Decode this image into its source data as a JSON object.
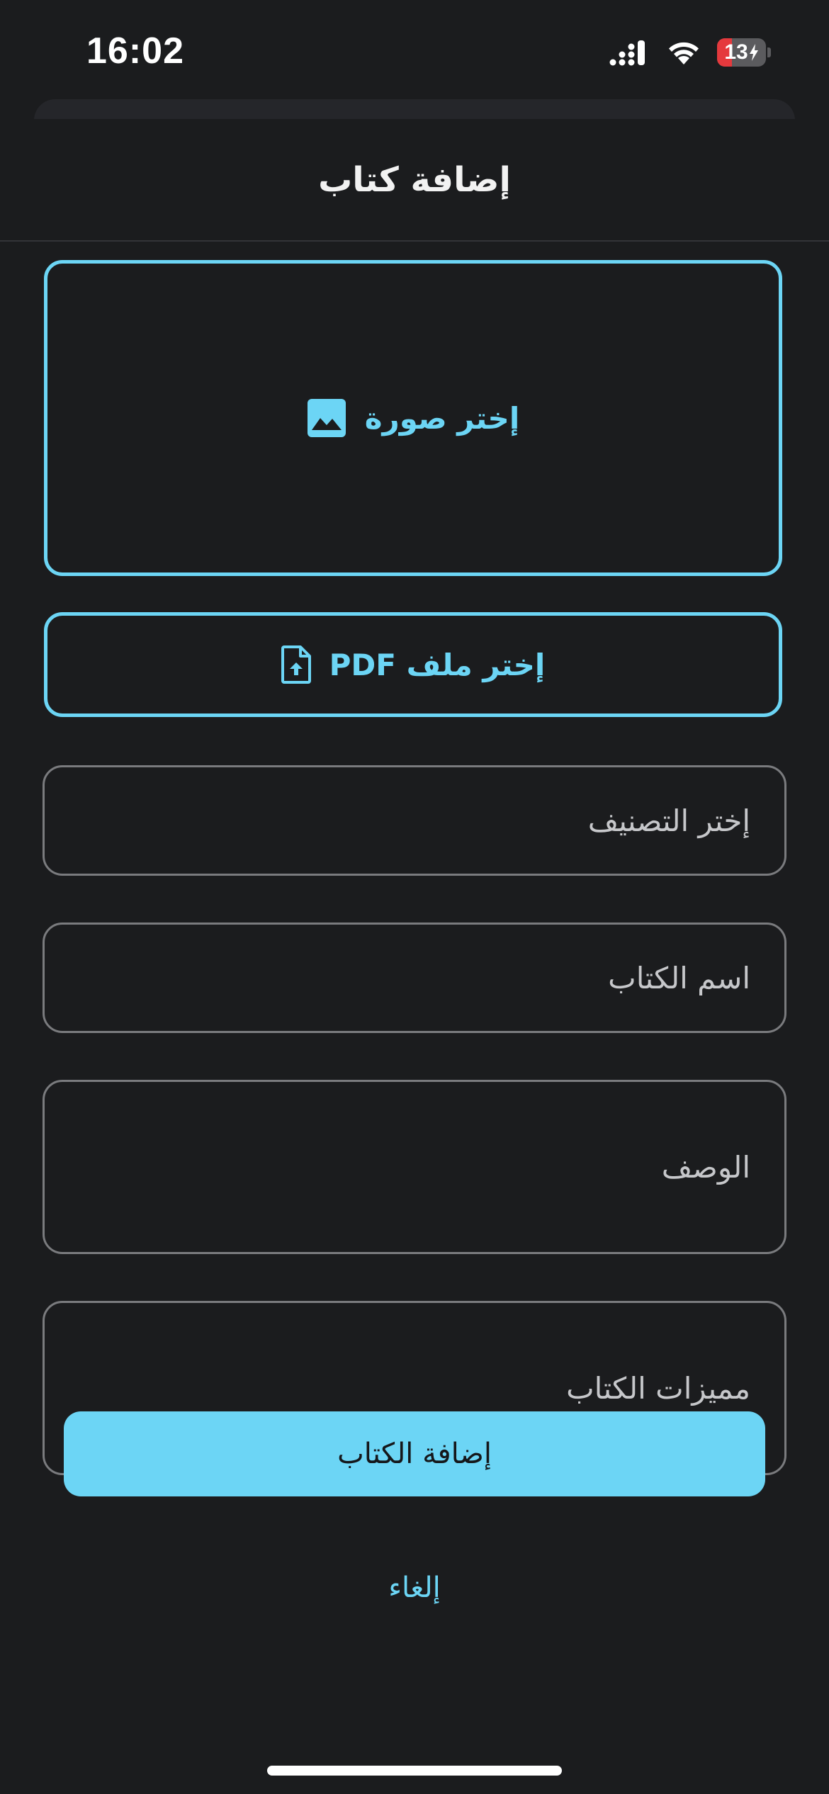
{
  "status_bar": {
    "time": "16:02",
    "battery_level": "13",
    "battery_fraction": 0.13,
    "charging": true,
    "icons": [
      "cellular-signal-icon",
      "wifi-icon",
      "battery-charging-icon"
    ]
  },
  "sheet": {
    "title": "إضافة كتاب"
  },
  "image_picker": {
    "label": "إختر صورة",
    "icon": "image-icon"
  },
  "pdf_picker": {
    "label": "إختر ملف PDF",
    "icon": "file-upload-icon"
  },
  "form": {
    "category": {
      "placeholder": "إختر التصنيف",
      "value": ""
    },
    "name": {
      "placeholder": "اسم الكتاب",
      "value": ""
    },
    "description": {
      "placeholder": "الوصف",
      "value": ""
    },
    "features": {
      "placeholder": "مميزات الكتاب",
      "value": ""
    }
  },
  "actions": {
    "submit_label": "إضافة الكتاب",
    "cancel_label": "إلغاء"
  },
  "colors": {
    "background": "#1b1c1e",
    "accent": "#6cd5f5",
    "field_border": "#7a7b7e",
    "placeholder": "#c6c7ca",
    "battery_low": "#e5393d"
  }
}
